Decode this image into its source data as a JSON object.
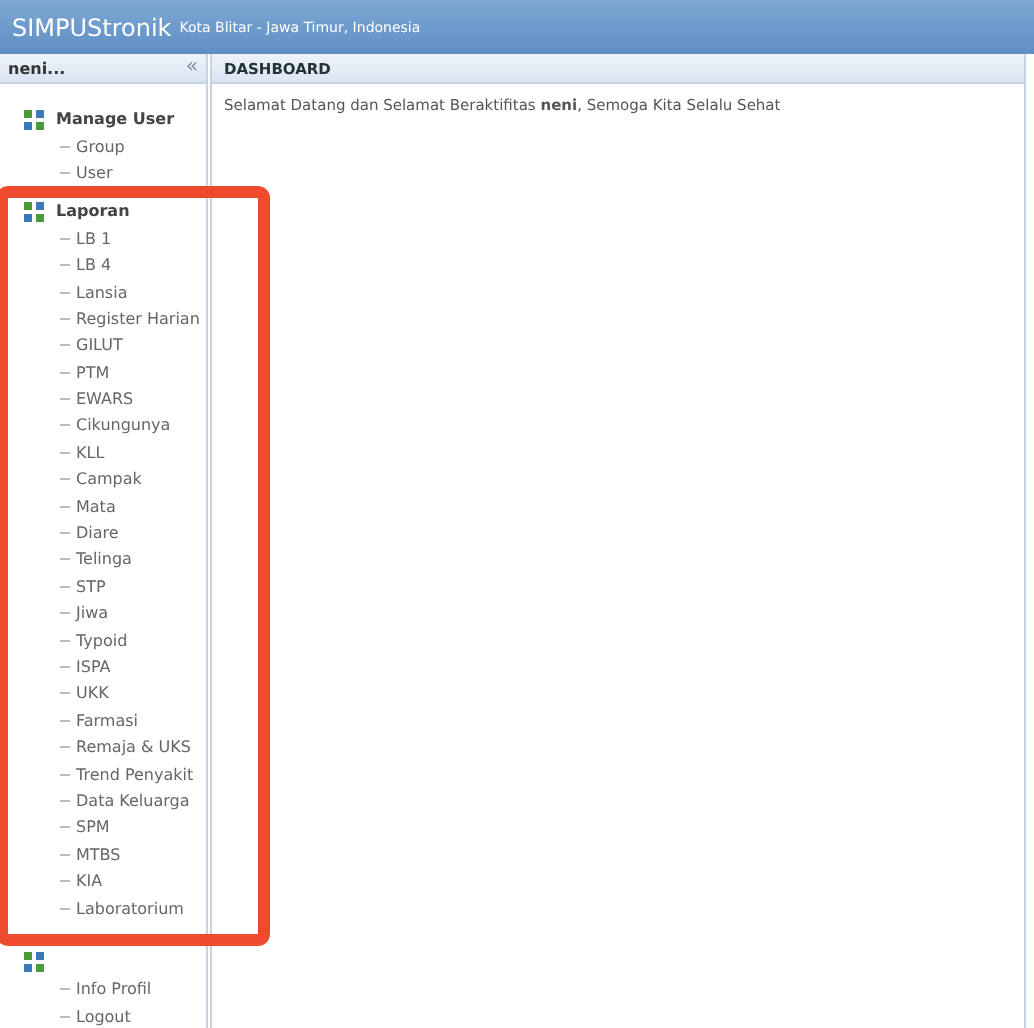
{
  "header": {
    "app_name": "SIMPUStronik",
    "region": "Kota Blitar - Jawa Timur, Indonesia"
  },
  "sidebar": {
    "user": "neni...",
    "collapse_icon": "«",
    "groups": [
      {
        "title": "Manage User",
        "items": [
          "Group",
          "User"
        ]
      },
      {
        "title": "Laporan",
        "highlighted": true,
        "items": [
          "LB 1",
          "LB 4",
          "Lansia",
          "Register Harian",
          "GILUT",
          "PTM",
          "EWARS",
          "Cikungunya",
          "KLL",
          "Campak",
          "Mata",
          "Diare",
          "Telinga",
          "STP",
          "Jiwa",
          "Typoid",
          "ISPA",
          "UKK",
          "Farmasi",
          "Remaja & UKS",
          "Trend Penyakit",
          "Data Keluarga",
          "SPM",
          "MTBS",
          "KIA",
          "Laboratorium"
        ]
      },
      {
        "items": [
          "Info Profil",
          "Logout"
        ]
      }
    ]
  },
  "content": {
    "title": "DASHBOARD",
    "message": "Selamat Datang dan Selamat Beraktifitas **neni**, Semoga Kita Selalu Sehat"
  }
}
